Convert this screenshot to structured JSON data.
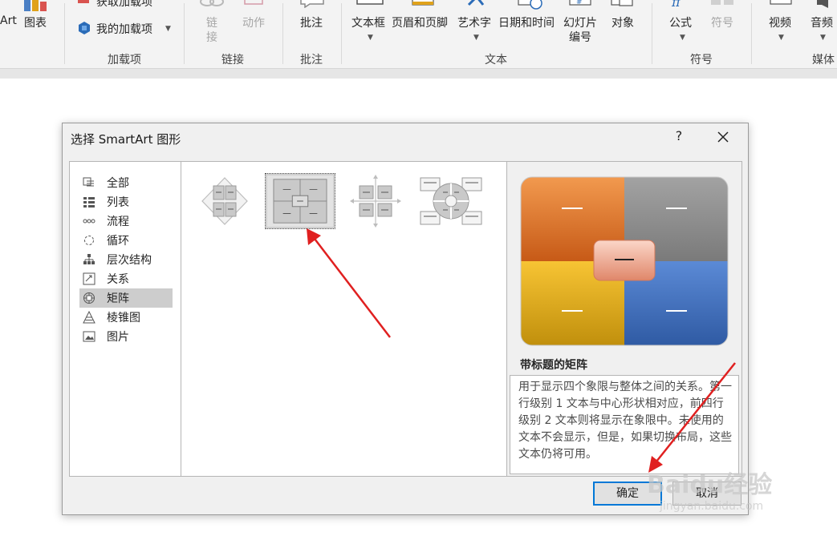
{
  "ribbon": {
    "art_partial": "Art",
    "chart": "图表",
    "get_addins_partial": "获取加载项",
    "my_addins": "我的加载项",
    "group_addins": "加载项",
    "link": "链接",
    "action": "动作",
    "group_links": "链接",
    "comment": "批注",
    "group_comments": "批注",
    "textbox": "文本框",
    "header_footer": "页眉和页脚",
    "wordart": "艺术字",
    "datetime": "日期和时间",
    "slide_number_1": "幻灯片",
    "slide_number_2": "编号",
    "object": "对象",
    "group_text": "文本",
    "equation": "公式",
    "symbol": "符号",
    "group_symbols": "符号",
    "video": "视频",
    "audio": "音频",
    "group_media": "媒体"
  },
  "dialog": {
    "title": "选择 SmartArt 图形",
    "help": "?",
    "categories": [
      {
        "label": "全部",
        "icon": "all-icon"
      },
      {
        "label": "列表",
        "icon": "list-icon"
      },
      {
        "label": "流程",
        "icon": "process-icon"
      },
      {
        "label": "循环",
        "icon": "cycle-icon"
      },
      {
        "label": "层次结构",
        "icon": "hierarchy-icon"
      },
      {
        "label": "关系",
        "icon": "relationship-icon"
      },
      {
        "label": "矩阵",
        "icon": "matrix-icon"
      },
      {
        "label": "棱锥图",
        "icon": "pyramid-icon"
      },
      {
        "label": "图片",
        "icon": "picture-icon"
      }
    ],
    "selected_category": "矩阵",
    "preview_title": "带标题的矩阵",
    "description": "用于显示四个象限与整体之间的关系。第一行级别 1 文本与中心形状相对应，前四行级别 2 文本则将显示在象限中。未使用的文本不会显示，但是，如果切换布局，这些文本仍将可用。",
    "ok": "确定",
    "cancel": "取消"
  },
  "watermark": {
    "brand": "Baidu经验",
    "url": "jingyan.baidu.com"
  },
  "colors": {
    "accent": "#0078d7",
    "arrow": "#e02020",
    "matrix_orange": "#e07a2e",
    "matrix_gray": "#8a8a8a",
    "matrix_yellow": "#e0a81a",
    "matrix_blue": "#3f6fc0"
  }
}
